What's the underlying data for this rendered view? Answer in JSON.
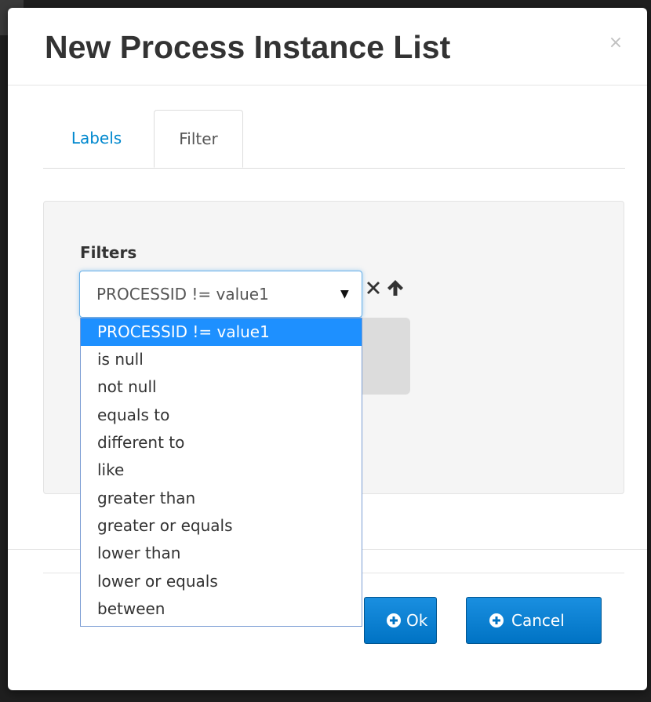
{
  "dialog": {
    "title": "New Process Instance List",
    "close_label": "×"
  },
  "tabs": [
    {
      "label": "Labels",
      "active": false
    },
    {
      "label": "Filter",
      "active": true
    }
  ],
  "filters": {
    "label": "Filters",
    "selected_value": "PROCESSID != value1",
    "dropdown_arrow": "▼",
    "options": [
      {
        "label": "PROCESSID != value1",
        "selected": true
      },
      {
        "label": "is null",
        "selected": false
      },
      {
        "label": "not null",
        "selected": false
      },
      {
        "label": "equals to",
        "selected": false
      },
      {
        "label": "different to",
        "selected": false
      },
      {
        "label": "like",
        "selected": false
      },
      {
        "label": "greater than",
        "selected": false
      },
      {
        "label": "greater or equals",
        "selected": false
      },
      {
        "label": "lower than",
        "selected": false
      },
      {
        "label": "lower or equals",
        "selected": false
      },
      {
        "label": "between",
        "selected": false
      }
    ],
    "remove_icon": "remove-icon",
    "move_up_icon": "arrow-up-icon"
  },
  "footer": {
    "ok_label": "Ok",
    "cancel_label": "Cancel",
    "button_icon": "plus-circle-icon"
  },
  "colors": {
    "link_blue": "#0088ce",
    "primary_button": "#0073c4",
    "selected_option": "#1e90ff",
    "panel_background": "#f5f5f5"
  }
}
